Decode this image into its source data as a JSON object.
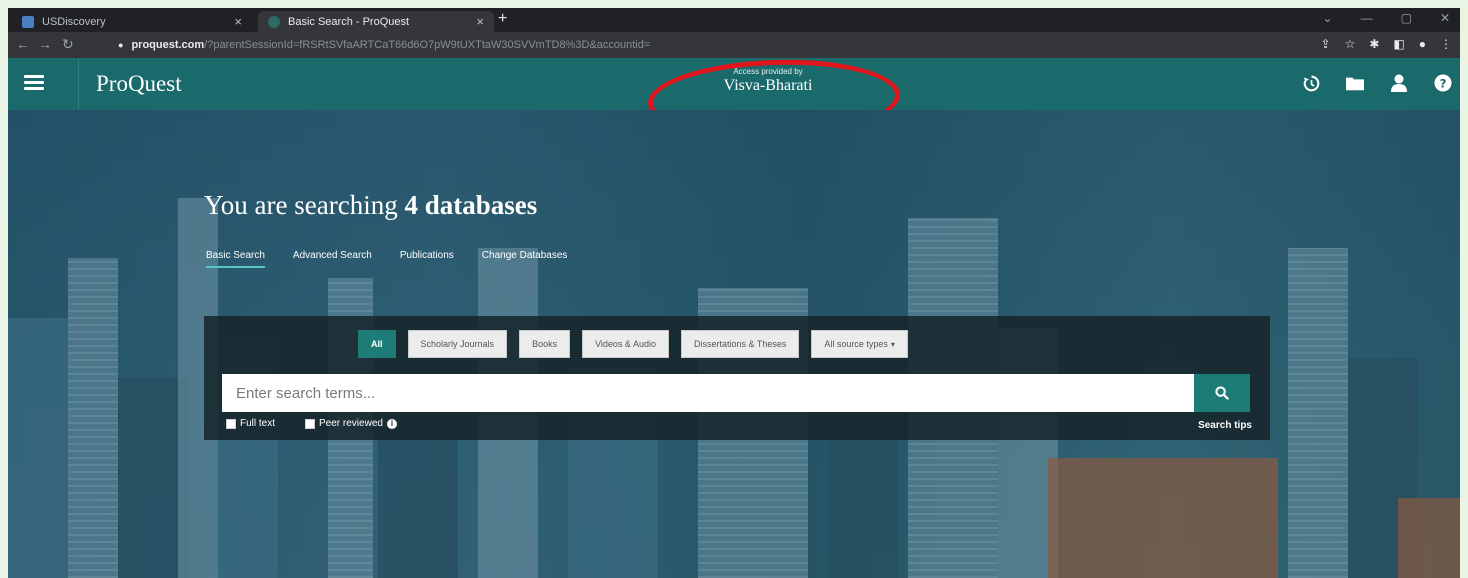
{
  "browser": {
    "tabs": [
      {
        "title": "USDiscovery",
        "favicon": "library-icon"
      },
      {
        "title": "Basic Search - ProQuest",
        "favicon": "proquest-icon",
        "active": true
      }
    ],
    "url_host": "proquest.com",
    "url_path": "/?parentSessionId=fRSRtSVfaARTCaT66d6O7pW9tUXTtaW30SVVmTD8%3D&accountid=",
    "tab_close": "×",
    "new_tab": "+"
  },
  "header": {
    "logo": "ProQuest",
    "access_label": "Access provided by",
    "institution": "Visva-Bharati",
    "brand_color": "#1b6a6b",
    "icons": [
      "history-icon",
      "folder-icon",
      "user-icon",
      "help-icon"
    ],
    "help_glyph": "?"
  },
  "hero": {
    "headline_prefix": "You are searching",
    "headline_bold": "4 databases",
    "tabs": [
      {
        "label": "Basic Search",
        "active": true
      },
      {
        "label": "Advanced Search"
      },
      {
        "label": "Publications"
      },
      {
        "label": "Change Databases"
      }
    ]
  },
  "search": {
    "source_types": [
      "All",
      "Scholarly Journals",
      "Books",
      "Videos & Audio",
      "Dissertations & Theses"
    ],
    "all_source_types": "All source types",
    "placeholder": "Enter search terms...",
    "full_text_label": "Full text",
    "peer_reviewed_label": "Peer reviewed",
    "search_tips": "Search tips",
    "accent_color": "#1d7c76"
  }
}
